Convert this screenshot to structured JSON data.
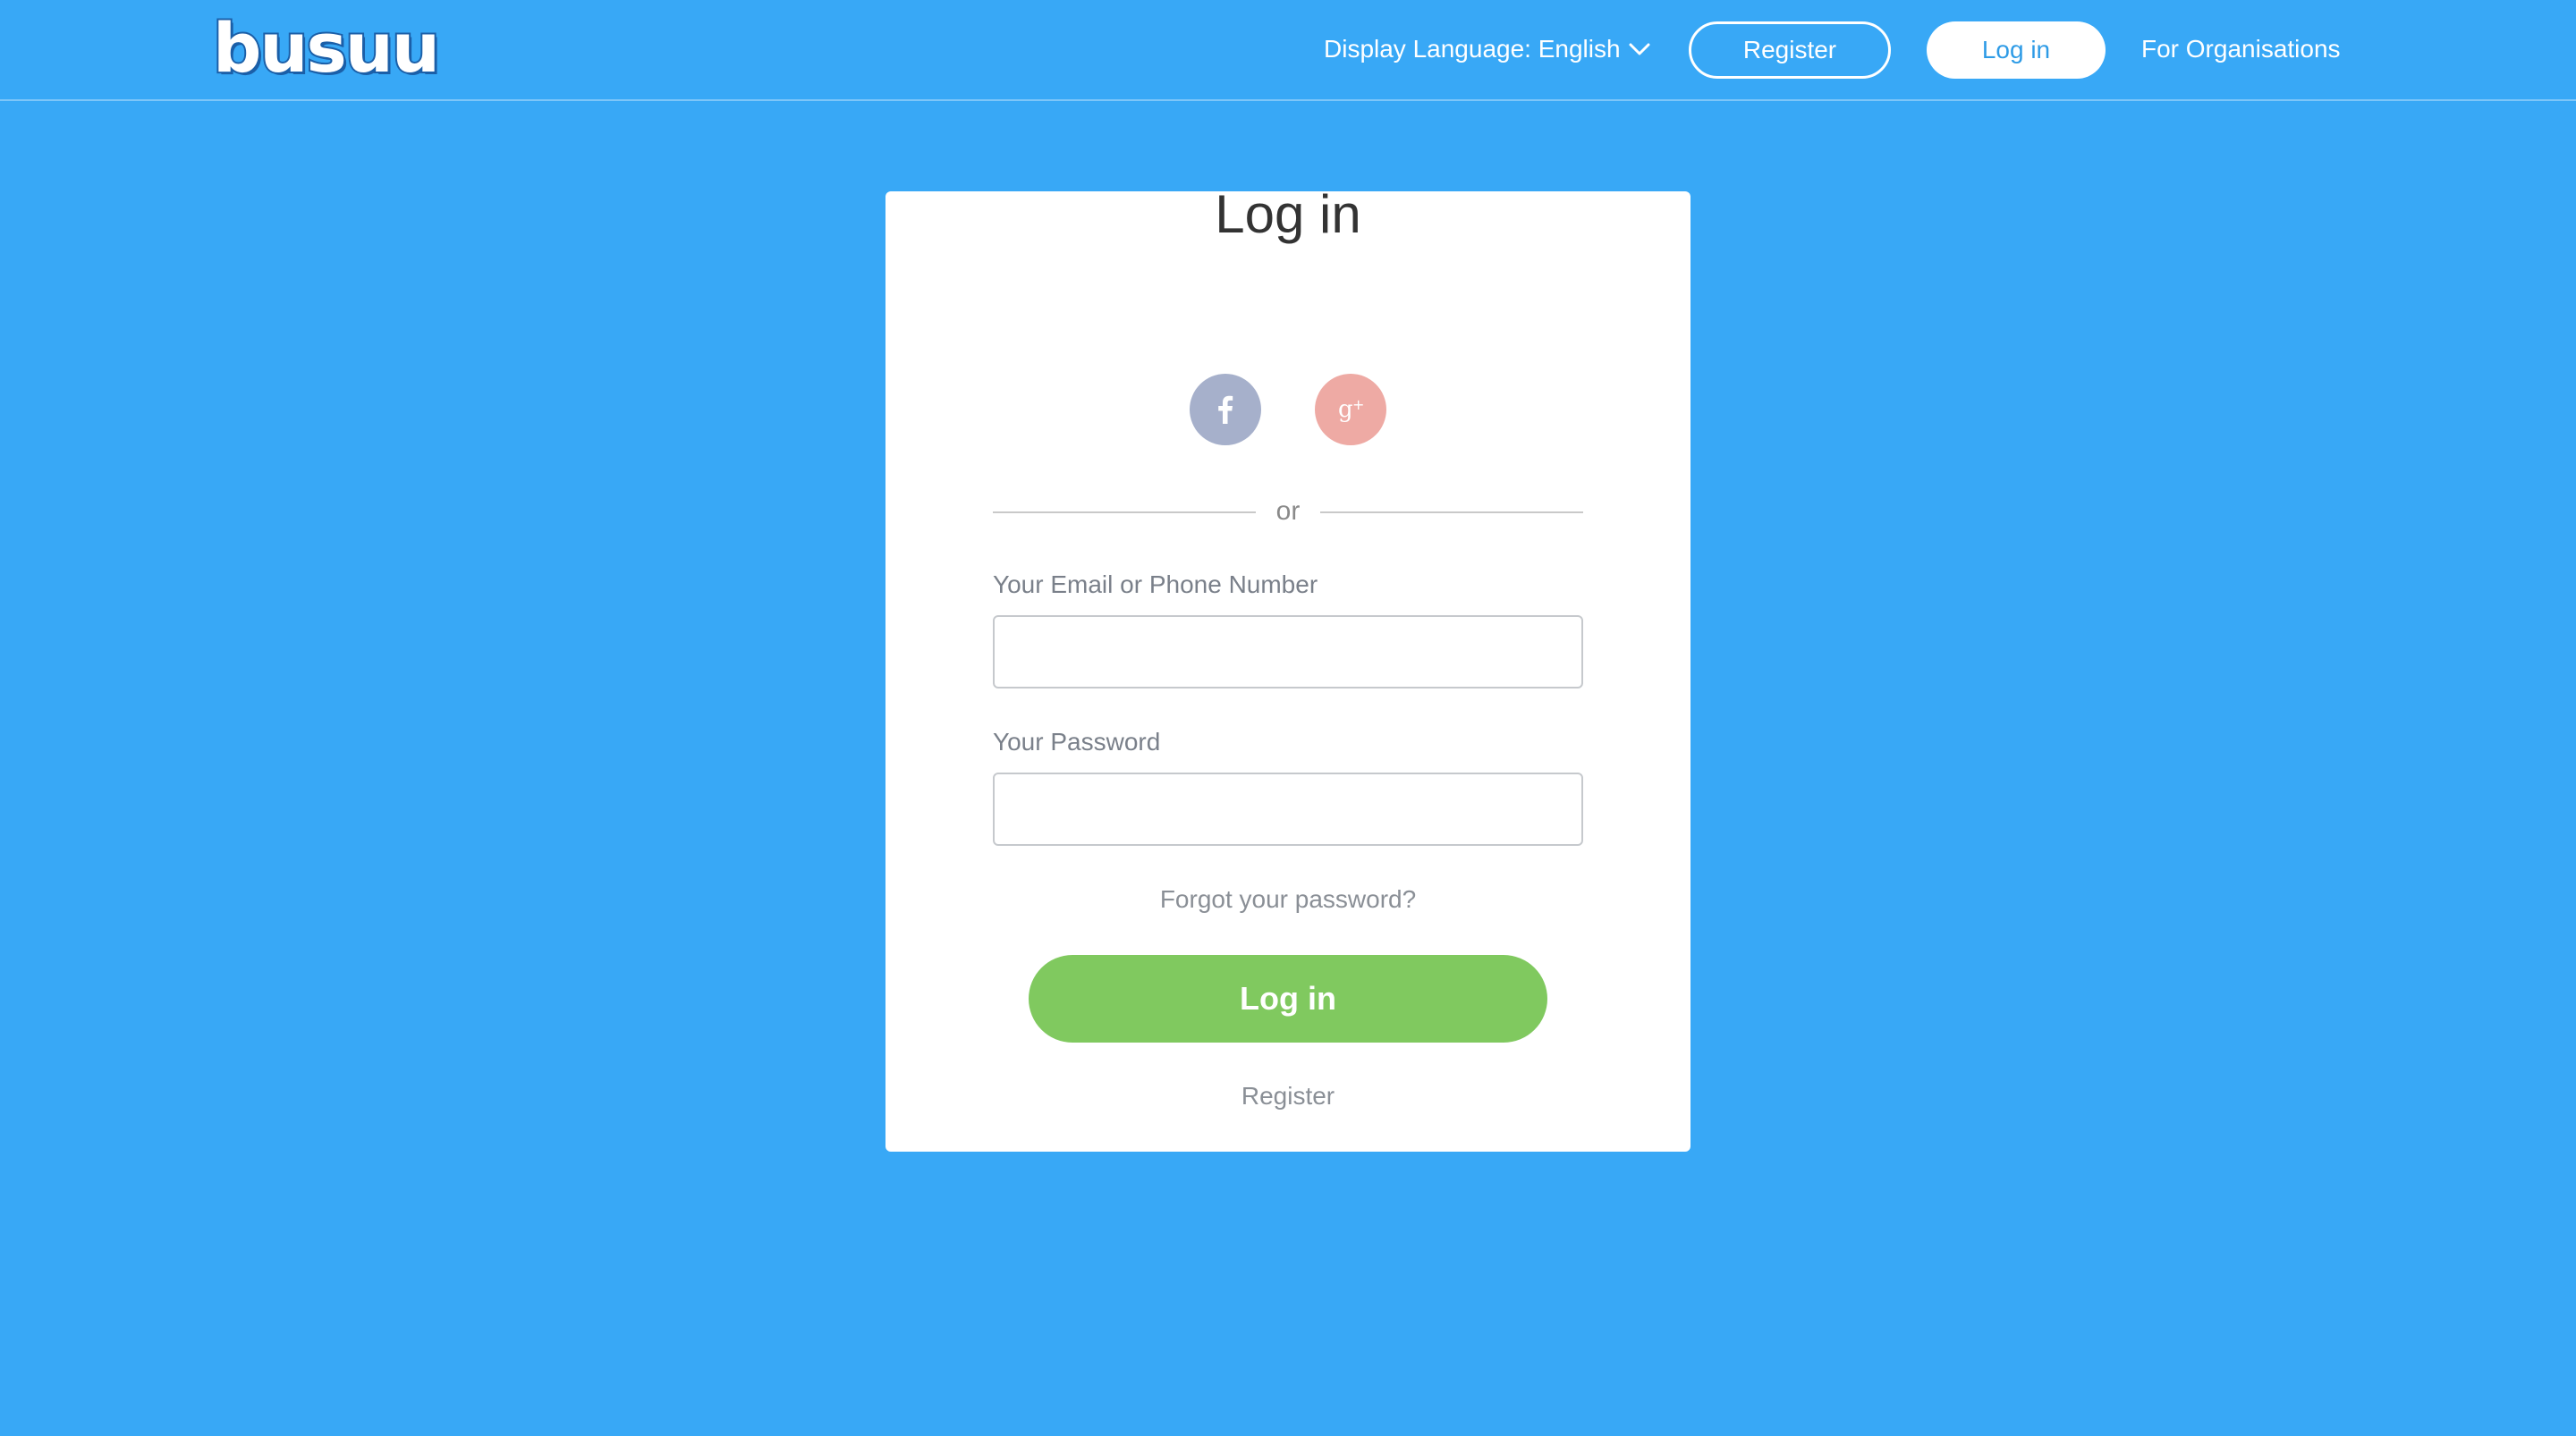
{
  "header": {
    "logo_text": "busuu",
    "display_language_label": "Display Language: English",
    "register_label": "Register",
    "login_label": "Log in",
    "for_organisations_label": "For Organisations"
  },
  "login_card": {
    "title": "Log in",
    "social": {
      "facebook_icon": "facebook-icon",
      "google_plus_icon": "google-plus-icon"
    },
    "divider_text": "or",
    "email_label": "Your Email or Phone Number",
    "email_value": "",
    "password_label": "Your Password",
    "password_value": "",
    "forgot_password_label": "Forgot your password?",
    "login_button_label": "Log in",
    "register_link_label": "Register"
  },
  "colors": {
    "background": "#38a8f6",
    "login_button": "#80c95f",
    "facebook": "#a6b0cb",
    "google_plus": "#eeaaa4"
  }
}
